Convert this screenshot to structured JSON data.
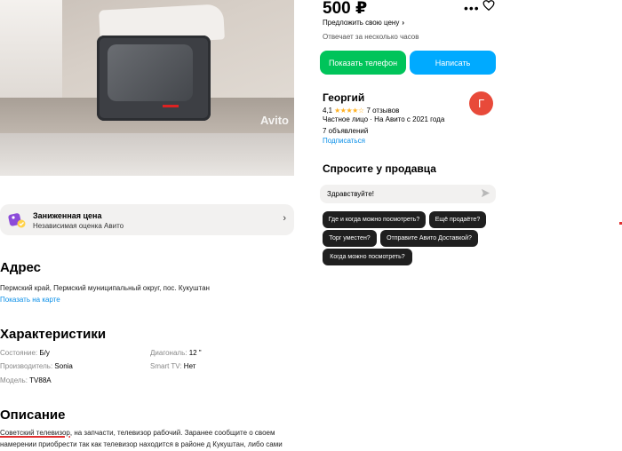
{
  "photo": {
    "watermark": "Avito"
  },
  "price_badge": {
    "title": "Заниженная цена",
    "subtitle": "Независимая оценка Авито",
    "chevron": "›",
    "icon": "price-tag-icon"
  },
  "address": {
    "heading": "Адрес",
    "text": "Пермский край, Пермский муниципальный округ, пос. Кукуштан",
    "map_link": "Показать на карте"
  },
  "specs": {
    "heading": "Характеристики",
    "items": [
      {
        "key": "Состояние:",
        "value": "Б/у"
      },
      {
        "key": "Диагональ:",
        "value": "12 \""
      },
      {
        "key": "Производитель:",
        "value": "Sonia"
      },
      {
        "key": "Smart TV:",
        "value": "Нет"
      },
      {
        "key": "Модель:",
        "value": "TV88A"
      }
    ]
  },
  "description": {
    "heading": "Описание",
    "highlight": "Советский телевизор",
    "rest": ", на запчасти, телевизор рабочий. Заранее сообщите о своем намерении приобрести так как телевизор находится в районе д Кукуштан, либо сами"
  },
  "listing": {
    "price": "500 ₽",
    "offer_price": "Предложить свою цену",
    "response_time": "Отвечает за несколько часов",
    "show_phone": "Показать телефон",
    "write": "Написать",
    "more_icon": "more-icon",
    "favorite_icon": "heart-icon"
  },
  "seller": {
    "name": "Георгий",
    "rating": "4,1",
    "stars": "★★★★☆",
    "reviews": "7 отзывов",
    "meta": "Частное лицо · На Авито с 2021 года",
    "ads": "7 объявлений",
    "subscribe": "Подписаться",
    "avatar_letter": "Г",
    "avatar_color": "#e84a3a"
  },
  "ask": {
    "heading": "Спросите у продавца",
    "input_value": "Здравствуйте!",
    "chips": [
      "Где и когда можно посмотреть?",
      "Ещё продаёте?",
      "Торг уместен?",
      "Отправите Авито Доставкой?",
      "Когда можно посмотреть?"
    ]
  },
  "colors": {
    "green": "#00c45a",
    "blue": "#00aaff",
    "link": "#0a8fe8",
    "star": "#ffb021"
  }
}
